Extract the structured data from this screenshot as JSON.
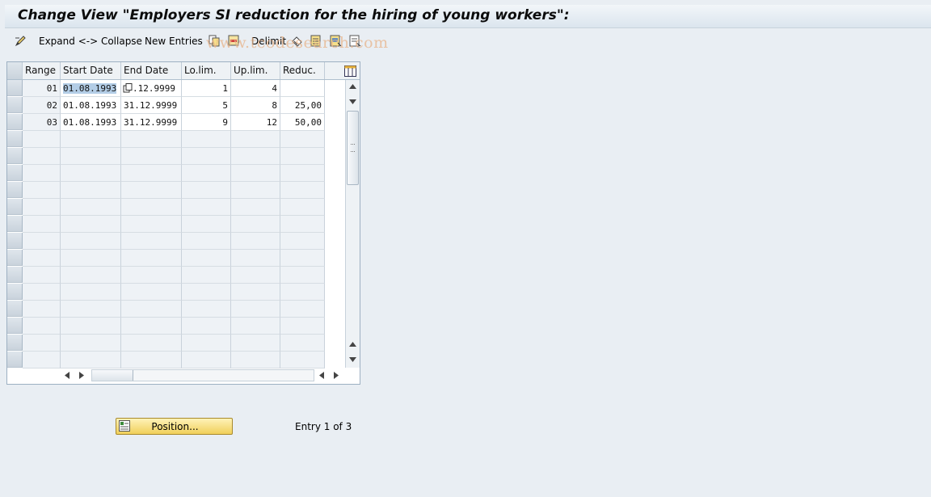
{
  "window": {
    "title": "Change View \"Employers SI reduction for the hiring of young workers\":"
  },
  "toolbar": {
    "expand_collapse": "Expand <-> Collapse",
    "new_entries": "New Entries",
    "delimit": "Delimit",
    "watermark": "www.tcodesearch.com"
  },
  "table": {
    "columns": [
      "Range",
      "Start Date",
      "End Date",
      "Lo.lim.",
      "Up.lim.",
      "Reduc."
    ],
    "rows": [
      {
        "range": "01",
        "start": "01.08.1993",
        "end": ".12.9999",
        "lo": "1",
        "up": "4",
        "reduc": ""
      },
      {
        "range": "02",
        "start": "01.08.1993",
        "end": "31.12.9999",
        "lo": "5",
        "up": "8",
        "reduc": "25,00"
      },
      {
        "range": "03",
        "start": "01.08.1993",
        "end": "31.12.9999",
        "lo": "9",
        "up": "12",
        "reduc": "50,00"
      }
    ],
    "empty_rows": 14
  },
  "footer": {
    "position_button": "Position...",
    "entry_info": "Entry 1 of 3"
  }
}
